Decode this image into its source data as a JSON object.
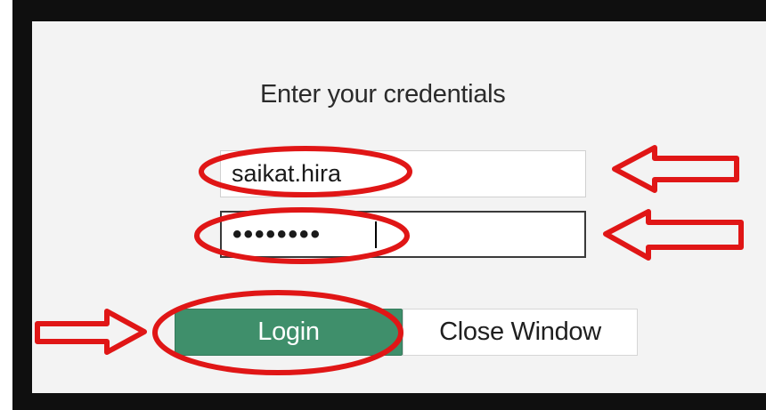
{
  "dialog": {
    "title": "Enter your credentials",
    "username_value": "saikat.hira",
    "password_mask": "••••••••"
  },
  "buttons": {
    "login_label": "Login",
    "close_label": "Close Window"
  },
  "colors": {
    "frame": "#0f0f0f",
    "panel": "#f3f3f3",
    "login_button": "#3f8f6b",
    "annotation_red": "#e01616"
  },
  "annotations": {
    "arrow_icons": [
      "username-arrow-icon",
      "password-arrow-icon",
      "login-arrow-icon"
    ],
    "highlight_icons": [
      "username-highlight-icon",
      "password-highlight-icon",
      "login-highlight-icon"
    ]
  }
}
